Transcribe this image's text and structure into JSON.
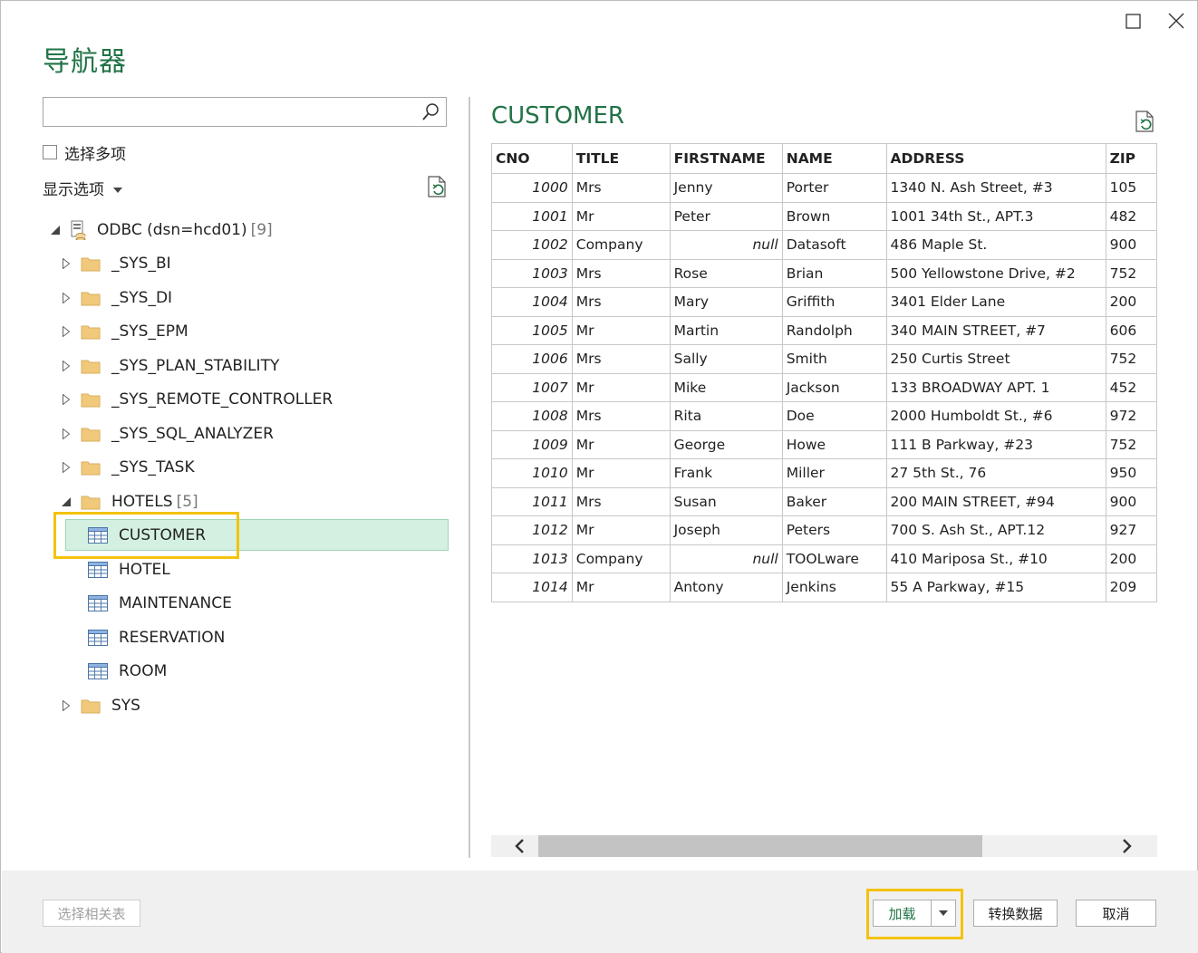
{
  "window": {
    "title": "导航器"
  },
  "search": {
    "placeholder": "",
    "value": ""
  },
  "select_multiple_label": "选择多项",
  "display_options_label": "显示选项",
  "tree": {
    "root": {
      "label": "ODBC (dsn=hcd01)",
      "count": "[9]"
    },
    "schemas": [
      {
        "label": "_SYS_BI"
      },
      {
        "label": "_SYS_DI"
      },
      {
        "label": "_SYS_EPM"
      },
      {
        "label": "_SYS_PLAN_STABILITY"
      },
      {
        "label": "_SYS_REMOTE_CONTROLLER"
      },
      {
        "label": "_SYS_SQL_ANALYZER"
      },
      {
        "label": "_SYS_TASK"
      },
      {
        "label": "HOTELS",
        "count": "[5]"
      },
      {
        "label": "SYS"
      }
    ],
    "tables": [
      {
        "label": "CUSTOMER"
      },
      {
        "label": "HOTEL"
      },
      {
        "label": "MAINTENANCE"
      },
      {
        "label": "RESERVATION"
      },
      {
        "label": "ROOM"
      }
    ]
  },
  "preview": {
    "title": "CUSTOMER",
    "columns": [
      "CNO",
      "TITLE",
      "FIRSTNAME",
      "NAME",
      "ADDRESS",
      "ZIP"
    ],
    "rows": [
      [
        "1000",
        "Mrs",
        "Jenny",
        "Porter",
        "1340 N. Ash Street, #3",
        "105"
      ],
      [
        "1001",
        "Mr",
        "Peter",
        "Brown",
        "1001 34th St., APT.3",
        "482"
      ],
      [
        "1002",
        "Company",
        "null",
        "Datasoft",
        "486 Maple St.",
        "900"
      ],
      [
        "1003",
        "Mrs",
        "Rose",
        "Brian",
        "500 Yellowstone Drive, #2",
        "752"
      ],
      [
        "1004",
        "Mrs",
        "Mary",
        "Griffith",
        "3401 Elder Lane",
        "200"
      ],
      [
        "1005",
        "Mr",
        "Martin",
        "Randolph",
        "340 MAIN STREET, #7",
        "606"
      ],
      [
        "1006",
        "Mrs",
        "Sally",
        "Smith",
        "250 Curtis Street",
        "752"
      ],
      [
        "1007",
        "Mr",
        "Mike",
        "Jackson",
        "133 BROADWAY APT. 1",
        "452"
      ],
      [
        "1008",
        "Mrs",
        "Rita",
        "Doe",
        "2000 Humboldt St., #6",
        "972"
      ],
      [
        "1009",
        "Mr",
        "George",
        "Howe",
        "111 B Parkway, #23",
        "752"
      ],
      [
        "1010",
        "Mr",
        "Frank",
        "Miller",
        "27 5th St., 76",
        "950"
      ],
      [
        "1011",
        "Mrs",
        "Susan",
        "Baker",
        "200 MAIN STREET, #94",
        "900"
      ],
      [
        "1012",
        "Mr",
        "Joseph",
        "Peters",
        "700 S. Ash St., APT.12",
        "927"
      ],
      [
        "1013",
        "Company",
        "null",
        "TOOLware",
        "410 Mariposa St., #10",
        "200"
      ],
      [
        "1014",
        "Mr",
        "Antony",
        "Jenkins",
        "55 A Parkway, #15",
        "209"
      ]
    ]
  },
  "footer": {
    "select_related_label": "选择相关表",
    "load_label": "加载",
    "transform_label": "转换数据",
    "cancel_label": "取消"
  },
  "colors": {
    "accent": "#217346",
    "selection_bg": "#d3f0e0",
    "highlight": "#f4c20d"
  },
  "icons": {
    "maximize": "maximize-icon",
    "close": "close-icon",
    "search": "search-icon",
    "refresh": "refresh-icon",
    "database": "database-icon",
    "folder": "folder-icon",
    "table": "table-icon"
  }
}
